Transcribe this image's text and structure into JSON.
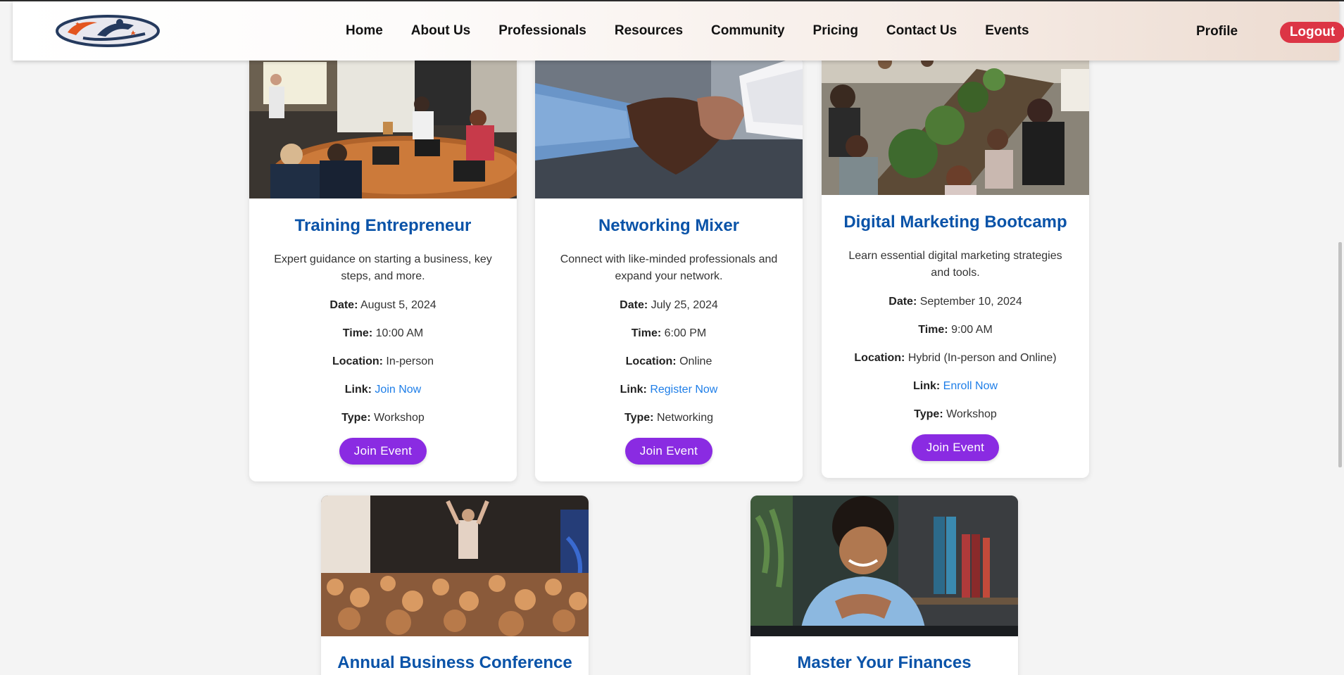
{
  "nav": {
    "links": [
      "Home",
      "About Us",
      "Professionals",
      "Resources",
      "Community",
      "Pricing",
      "Contact Us",
      "Events"
    ],
    "profile": "Profile",
    "logout": "Logout"
  },
  "colors": {
    "title": "#0a53a8",
    "link": "#1e7ee8",
    "button": "#8a2be2",
    "logout": "#dc3545"
  },
  "labels": {
    "date": "Date:",
    "time": "Time:",
    "location": "Location:",
    "link": "Link:",
    "type": "Type:"
  },
  "events": [
    {
      "title": "Training Entrepreneur",
      "description": "Expert guidance on starting a business, key steps, and more.",
      "date": "August 5, 2024",
      "time": "10:00 AM",
      "location": "In-person",
      "link_text": "Join Now",
      "type": "Workshop",
      "button": "Join Event",
      "image": "meeting-room-photo"
    },
    {
      "title": "Networking Mixer",
      "description": "Connect with like-minded professionals and expand your network.",
      "date": "July 25, 2024",
      "time": "6:00 PM",
      "location": "Online",
      "link_text": "Register Now",
      "type": "Networking",
      "button": "Join Event",
      "image": "handshake-photo"
    },
    {
      "title": "Digital Marketing Bootcamp",
      "description": "Learn essential digital marketing strategies and tools.",
      "date": "September 10, 2024",
      "time": "9:00 AM",
      "location": "Hybrid (In-person and Online)",
      "link_text": "Enroll Now",
      "type": "Workshop",
      "button": "Join Event",
      "image": "workshop-table-photo"
    },
    {
      "title": "Annual Business Conference",
      "image": "conference-crowd-photo"
    },
    {
      "title": "Master Your Finances",
      "image": "smiling-man-laptop-photo"
    }
  ]
}
